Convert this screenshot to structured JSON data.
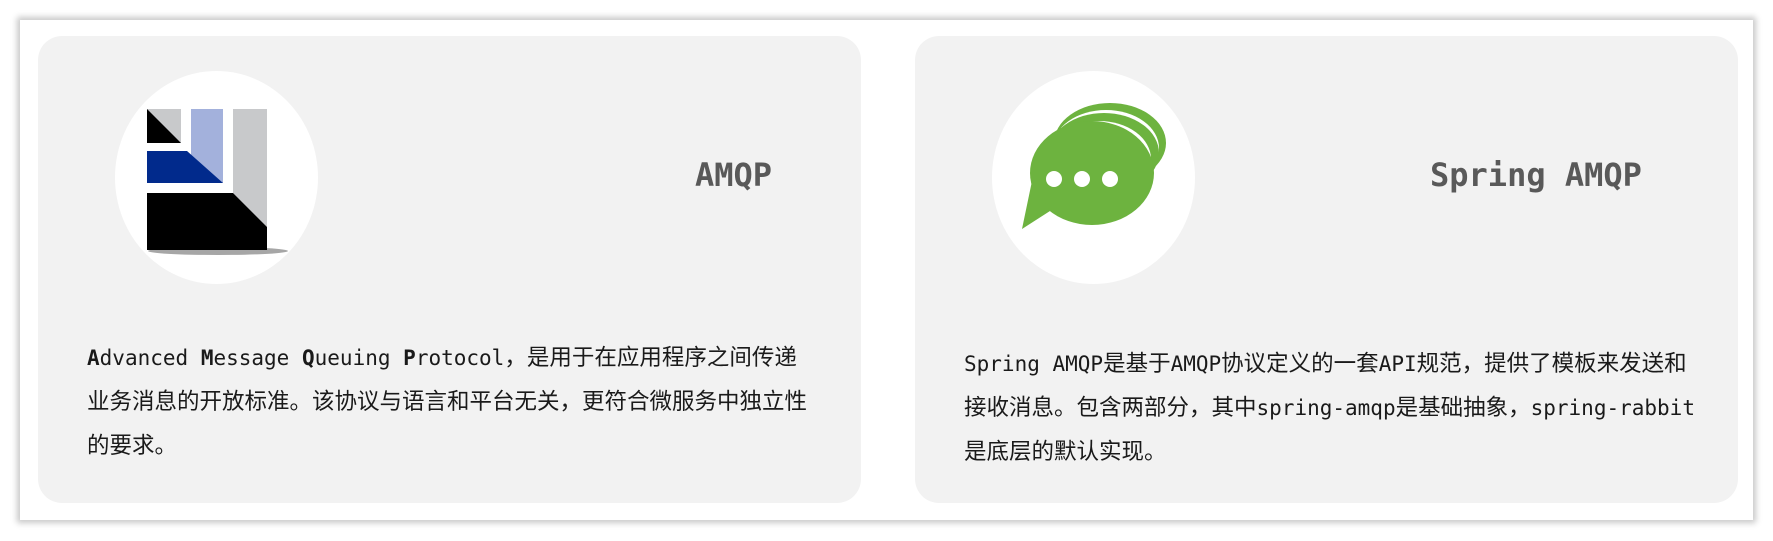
{
  "cards": [
    {
      "title": "AMQP",
      "logo_icon": "amqp-logo-icon",
      "desc": {
        "term_parts": [
          {
            "t": "A",
            "bold": true
          },
          {
            "t": "dvanced ",
            "bold": false
          },
          {
            "t": "M",
            "bold": true
          },
          {
            "t": "essage ",
            "bold": false
          },
          {
            "t": "Q",
            "bold": true
          },
          {
            "t": "ueuing ",
            "bold": false
          },
          {
            "t": "P",
            "bold": true
          },
          {
            "t": "rotocol",
            "bold": false
          }
        ],
        "text": "，是用于在应用程序之间传递业务消息的开放标准。该协议与语言和平台无关，更符合微服务中独立性的要求。"
      }
    },
    {
      "title": "Spring AMQP",
      "logo_icon": "chat-bubble-icon",
      "desc": {
        "segments": [
          {
            "t": "Spring AMQP",
            "mono": true
          },
          {
            "t": "是基于",
            "mono": false
          },
          {
            "t": "AMQP",
            "mono": true
          },
          {
            "t": "协议定义的一套",
            "mono": false
          },
          {
            "t": "API",
            "mono": true
          },
          {
            "t": "规范，提供了模板来发送和接收消息。包含两部分，其中",
            "mono": false
          },
          {
            "t": "spring-amqp",
            "mono": true
          },
          {
            "t": "是基础抽象，",
            "mono": false
          },
          {
            "t": "spring-rabbit",
            "mono": true
          },
          {
            "t": "是底层的默认实现。",
            "mono": false
          }
        ]
      }
    }
  ],
  "colors": {
    "card_bg": "#f2f2f2",
    "title": "#595959",
    "amqp_blue": "#012a8c",
    "amqp_light_blue": "#a3b1dc",
    "amqp_gray": "#c8c9cb",
    "chat_green": "#6db33f"
  }
}
